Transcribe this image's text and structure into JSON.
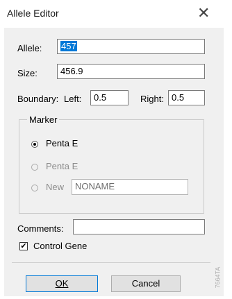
{
  "window": {
    "title": "Allele Editor",
    "close_glyph": "✕"
  },
  "allele": {
    "label": "Allele:",
    "value": "457"
  },
  "size": {
    "label": "Size:",
    "value": "456.9"
  },
  "boundary": {
    "label": "Boundary:",
    "left_label": "Left:",
    "left_value": "0.5",
    "right_label": "Right:",
    "right_value": "0.5"
  },
  "marker": {
    "legend": "Marker",
    "options": [
      {
        "label": "Penta E",
        "selected": true,
        "enabled": true
      },
      {
        "label": "Penta E",
        "selected": false,
        "enabled": false
      },
      {
        "label": "New",
        "selected": false,
        "enabled": false
      }
    ],
    "new_value": "NONAME"
  },
  "comments": {
    "label": "Comments:",
    "value": ""
  },
  "control_gene": {
    "label": "Control Gene",
    "checked": true,
    "check_glyph": "✔"
  },
  "buttons": {
    "ok": "OK",
    "cancel": "Cancel"
  },
  "watermark": "7664TA",
  "colors": {
    "selection": "#0078d7",
    "dialog_bg": "#f0f0f0"
  }
}
